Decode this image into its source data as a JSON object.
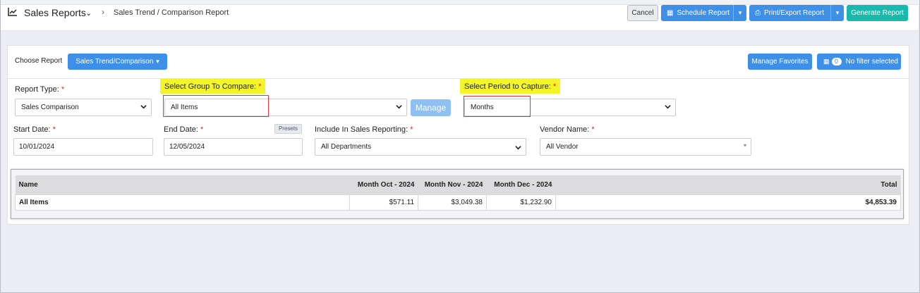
{
  "header": {
    "title": "Sales Reports",
    "breadcrumb": "Sales Trend / Comparison Report",
    "cancel_label": "Cancel",
    "schedule_label": "Schedule Report",
    "print_label": "Print/Export Report",
    "generate_label": "Generate Report"
  },
  "toolbar": {
    "choose_label": "Choose Report",
    "choose_value": "Sales Trend/Comparison",
    "manage_favorites_label": "Manage Favorites",
    "filter_count": "0",
    "filter_label": "No filter selected"
  },
  "form": {
    "report_type_label": "Report Type:",
    "report_type_value": "Sales Comparison",
    "group_label": "Select Group To Compare:",
    "group_value": "All Items",
    "manage_label": "Manage",
    "period_label": "Select Period to Capture:",
    "period_value": "Months",
    "start_label": "Start Date:",
    "start_value": "10/01/2024",
    "end_label": "End Date:",
    "end_value": "12/05/2024",
    "presets_label": "Presets",
    "include_label": "Include In Sales Reporting:",
    "include_value": "All Departments",
    "vendor_label": "Vendor Name:",
    "vendor_value": "All Vendor",
    "required_mark": "*"
  },
  "table": {
    "headers": [
      "Name",
      "Month Oct - 2024",
      "Month Nov - 2024",
      "Month Dec - 2024",
      "Total"
    ],
    "rows": [
      [
        "All Items",
        "$571.11",
        "$3,049.38",
        "$1,232.90",
        "$4,853.39"
      ]
    ]
  },
  "colors": {
    "primary": "#3d8fe8",
    "generate": "#19b9ad",
    "highlight": "#f3f52a",
    "required": "#d9252b"
  }
}
